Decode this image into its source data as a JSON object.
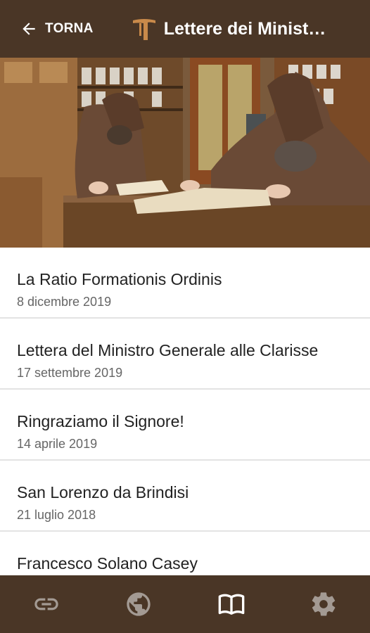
{
  "header": {
    "back_label": "TORNA",
    "title": "Lettere dei Minist…"
  },
  "colors": {
    "bar": "#4a3626",
    "logo": "#c98a4a",
    "icon": "#a39a93",
    "icon_active": "#ffffff"
  },
  "hero": {
    "image": "two-friars-reading-books-in-library"
  },
  "letters": [
    {
      "title": "La Ratio Formationis Ordinis",
      "date": "8 dicembre 2019"
    },
    {
      "title": "Lettera del Ministro Generale alle Clarisse",
      "date": "17 settembre 2019"
    },
    {
      "title": "Ringraziamo il Signore!",
      "date": "14 aprile 2019"
    },
    {
      "title": "San Lorenzo da Brindisi",
      "date": "21 luglio 2018"
    },
    {
      "title": "Francesco Solano Casey",
      "date": ""
    }
  ],
  "bottom_nav": {
    "items": [
      {
        "icon": "link-icon",
        "active": false
      },
      {
        "icon": "globe-icon",
        "active": false
      },
      {
        "icon": "book-icon",
        "active": true
      },
      {
        "icon": "gear-icon",
        "active": false
      }
    ]
  }
}
